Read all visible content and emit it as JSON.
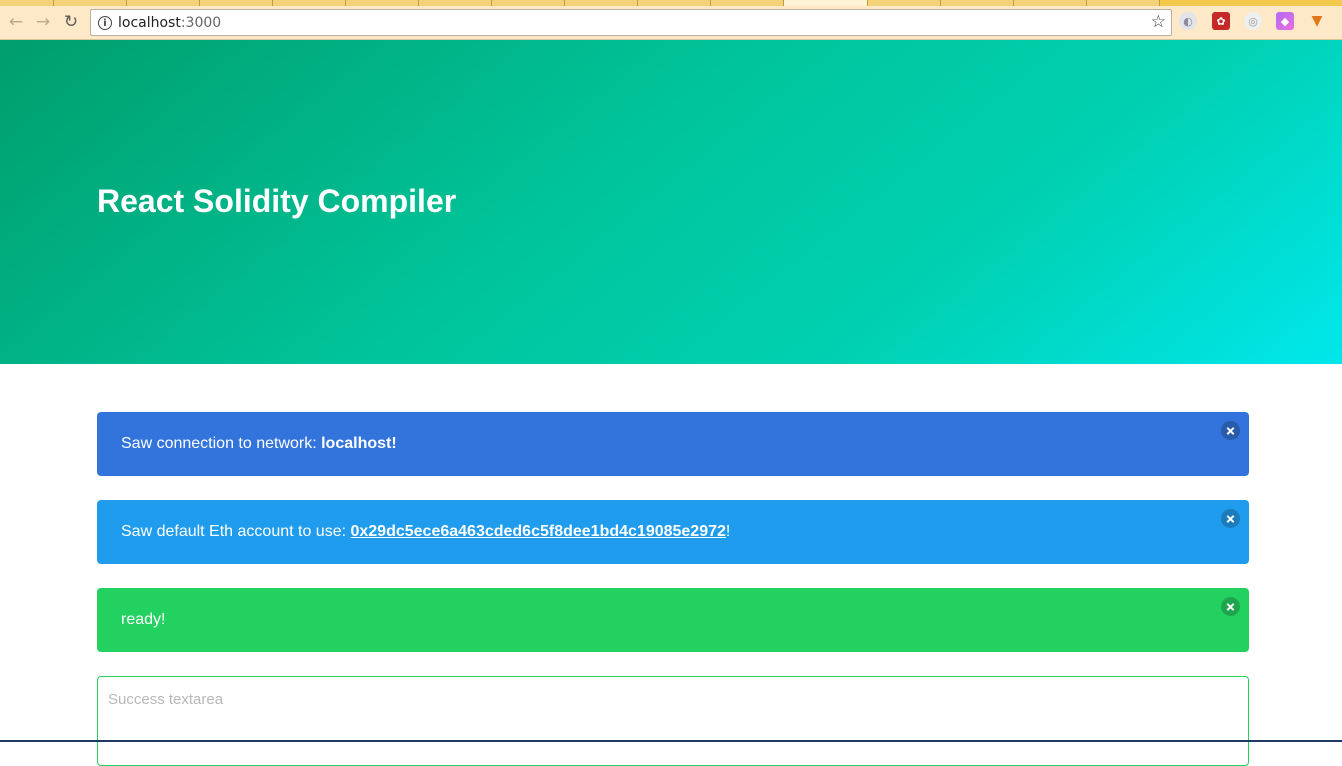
{
  "browser": {
    "url_host": "localhost",
    "url_port": ":3000",
    "icons": {
      "back": "back-arrow-icon",
      "forward": "forward-arrow-icon",
      "reload": "reload-icon",
      "info": "info-icon",
      "star": "bookmark-star-icon"
    },
    "extensions": [
      "extension-icon-1",
      "extension-icon-2",
      "extension-icon-3",
      "extension-icon-4",
      "metamask-fox-icon"
    ]
  },
  "hero": {
    "title": "React Solidity Compiler",
    "gradient_colors": [
      "#009e6c",
      "#00d1b2",
      "#00e7eb"
    ]
  },
  "notifications": [
    {
      "prefix": "Saw connection to network: ",
      "strong": "localhost",
      "suffix": "!",
      "color": "#3273dc"
    },
    {
      "prefix": "Saw default Eth account to use: ",
      "link": "0x29dc5ece6a463cded6c5f8dee1bd4c19085e2972",
      "suffix": "!",
      "color": "#209cee"
    },
    {
      "text": "ready!",
      "color": "#23d160"
    }
  ],
  "textarea": {
    "placeholder": "Success textarea",
    "value": ""
  }
}
